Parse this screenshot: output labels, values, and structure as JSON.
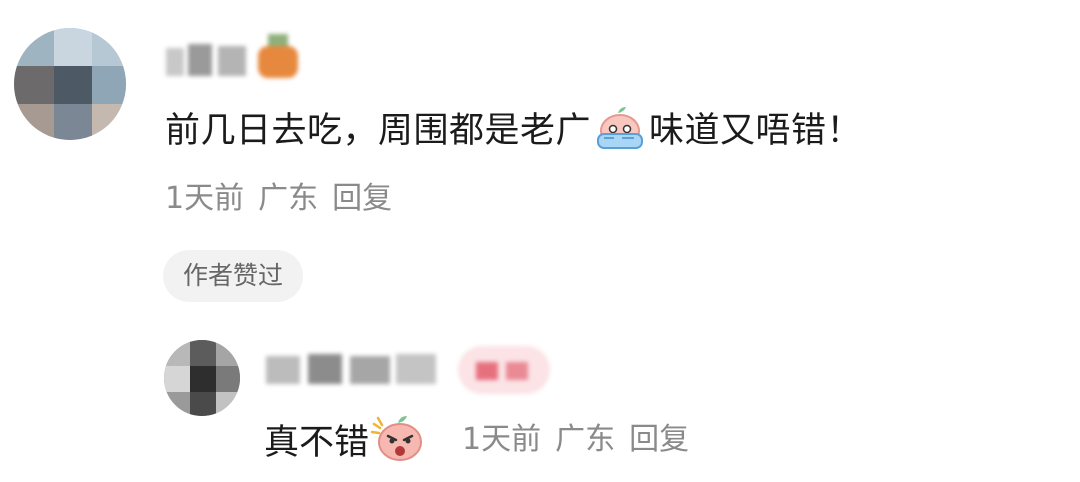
{
  "comment": {
    "text_before_emoji": "前几日去吃，周围都是老广",
    "emoji_icon": "crying-face-icon",
    "text_after_emoji": "味道又唔错！",
    "time": "1天前",
    "location": "广东",
    "reply_label": "回复",
    "badge": "作者赞过"
  },
  "reply": {
    "text": "真不错",
    "emoji_icon": "angry-face-icon",
    "time": "1天前",
    "location": "广东",
    "reply_label": "回复"
  },
  "colors": {
    "text": "#1b1b1b",
    "meta": "#8a8a8a",
    "badge_bg": "#f2f2f2",
    "badge_text": "#666666",
    "emoji_pink": "#f7b8b2"
  }
}
